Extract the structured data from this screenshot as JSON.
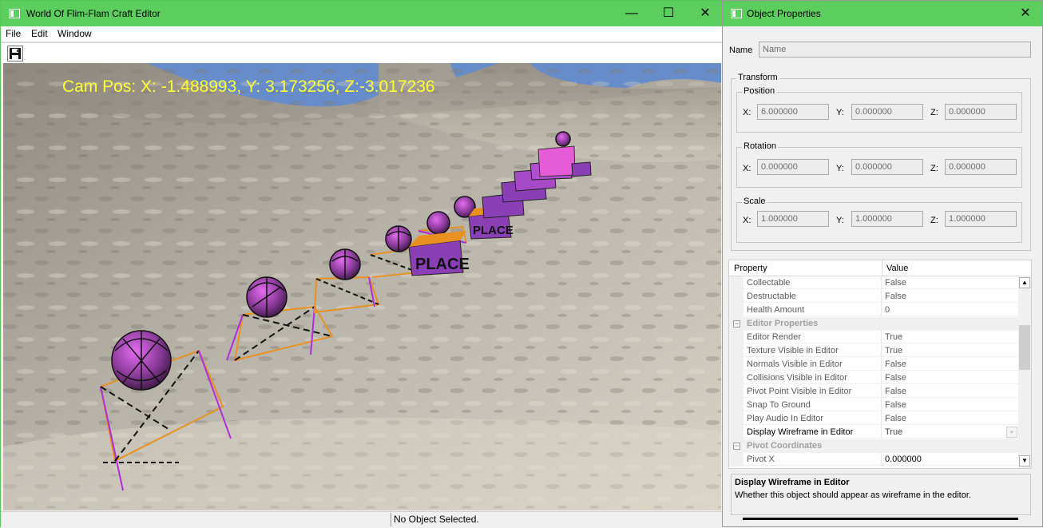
{
  "editor_window": {
    "title": "World Of Flim-Flam Craft Editor",
    "controls": {
      "minimize": "—",
      "maximize": "☐",
      "close": "✕"
    },
    "menu": [
      "File",
      "Edit",
      "Window"
    ],
    "toolbar": {
      "save_icon": "save-icon"
    },
    "viewport": {
      "cam_pos": "Cam Pos: X: -1.488993, Y: 3.173256, Z:-3.017236",
      "cam_color": "#ffff33",
      "sky_color": "#5b8fe4"
    },
    "status": "No Object Selected."
  },
  "props_window": {
    "title": "Object Properties",
    "close": "✕",
    "name_label": "Name",
    "name_placeholder": "Name",
    "transform_label": "Transform",
    "position": {
      "label": "Position",
      "x_label": "X:",
      "y_label": "Y:",
      "z_label": "Z:",
      "x": "6.000000",
      "y": "0.000000",
      "z": "0.000000"
    },
    "rotation": {
      "label": "Rotation",
      "x_label": "X:",
      "y_label": "Y:",
      "z_label": "Z:",
      "x": "0.000000",
      "y": "0.000000",
      "z": "0.000000"
    },
    "scale": {
      "label": "Scale",
      "x_label": "X:",
      "y_label": "Y:",
      "z_label": "Z:",
      "x": "1.000000",
      "y": "1.000000",
      "z": "1.000000"
    },
    "grid": {
      "col_property": "Property",
      "col_value": "Value",
      "rows": [
        {
          "name": "Collectable",
          "value": "False"
        },
        {
          "name": "Destructable",
          "value": "False"
        },
        {
          "name": "Health Amount",
          "value": "0"
        },
        {
          "category": "Editor Properties",
          "toggle": "⊟"
        },
        {
          "name": "Editor Render",
          "value": "True"
        },
        {
          "name": "Texture Visible in Editor",
          "value": "True"
        },
        {
          "name": "Normals Visible in Editor",
          "value": "False"
        },
        {
          "name": "Collisions Visible in Editor",
          "value": "False"
        },
        {
          "name": "Pivot Point Visible in Editor",
          "value": "False"
        },
        {
          "name": "Snap To Ground",
          "value": "False"
        },
        {
          "name": "Play Audio In Editor",
          "value": "False"
        },
        {
          "name": "Display Wireframe in Editor",
          "value": "True",
          "selected": true
        },
        {
          "category": "Pivot Coordinates",
          "toggle": "⊟"
        },
        {
          "name": "Pivot X",
          "value": "0.000000"
        }
      ],
      "scroll_up": "▲",
      "scroll_down": "▼",
      "dropdown": "⌄"
    },
    "description": {
      "title": "Display Wireframe in Editor",
      "text": "Whether this object should appear as wireframe in the editor."
    }
  }
}
